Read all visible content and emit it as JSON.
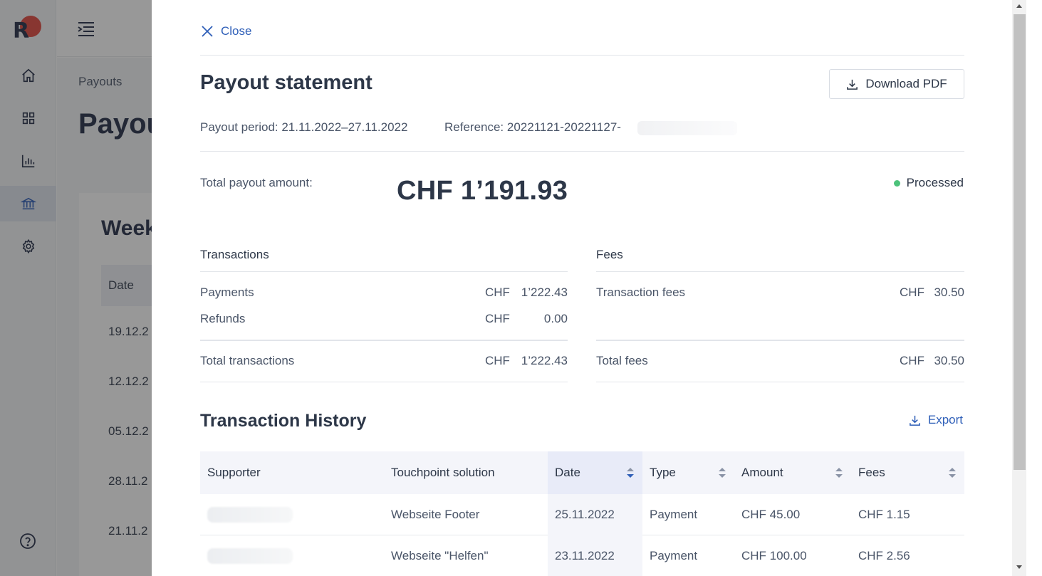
{
  "background": {
    "logo_letter": "R",
    "breadcrumb": "Payouts",
    "page_title": "Payou",
    "card_title": "Week",
    "table_header": "Date",
    "dates": [
      "19.12.2",
      "12.12.2",
      "05.12.2",
      "28.11.2",
      "21.11.2"
    ]
  },
  "drawer": {
    "close_label": "Close",
    "title": "Payout statement",
    "download_label": "Download PDF",
    "payout_period": "Payout period: 21.11.2022–27.11.2022",
    "reference": "Reference: 20221121-20221127-",
    "total_label": "Total payout amount:",
    "total_amount": "CHF 1’191.93",
    "status": "Processed",
    "colors": {
      "accent": "#2f5fb8",
      "status_green": "#4cc27a"
    }
  },
  "transactions": {
    "heading": "Transactions",
    "rows": [
      {
        "label": "Payments",
        "currency": "CHF",
        "value": "1’222.43"
      },
      {
        "label": "Refunds",
        "currency": "CHF",
        "value": "0.00"
      }
    ],
    "total": {
      "label": "Total transactions",
      "currency": "CHF",
      "value": "1’222.43"
    }
  },
  "fees": {
    "heading": "Fees",
    "rows": [
      {
        "label": "Transaction fees",
        "currency": "CHF",
        "value": "30.50"
      }
    ],
    "total": {
      "label": "Total fees",
      "currency": "CHF",
      "value": "30.50"
    }
  },
  "history": {
    "title": "Transaction History",
    "export_label": "Export",
    "columns": [
      "Supporter",
      "Touchpoint solution",
      "Date",
      "Type",
      "Amount",
      "Fees"
    ],
    "rows": [
      {
        "touchpoint": "Webseite Footer",
        "date": "25.11.2022",
        "type": "Payment",
        "amount": "CHF 45.00",
        "fees": "CHF 1.15"
      },
      {
        "touchpoint": "Webseite \"Helfen\"",
        "date": "23.11.2022",
        "type": "Payment",
        "amount": "CHF 100.00",
        "fees": "CHF 2.56"
      }
    ]
  }
}
